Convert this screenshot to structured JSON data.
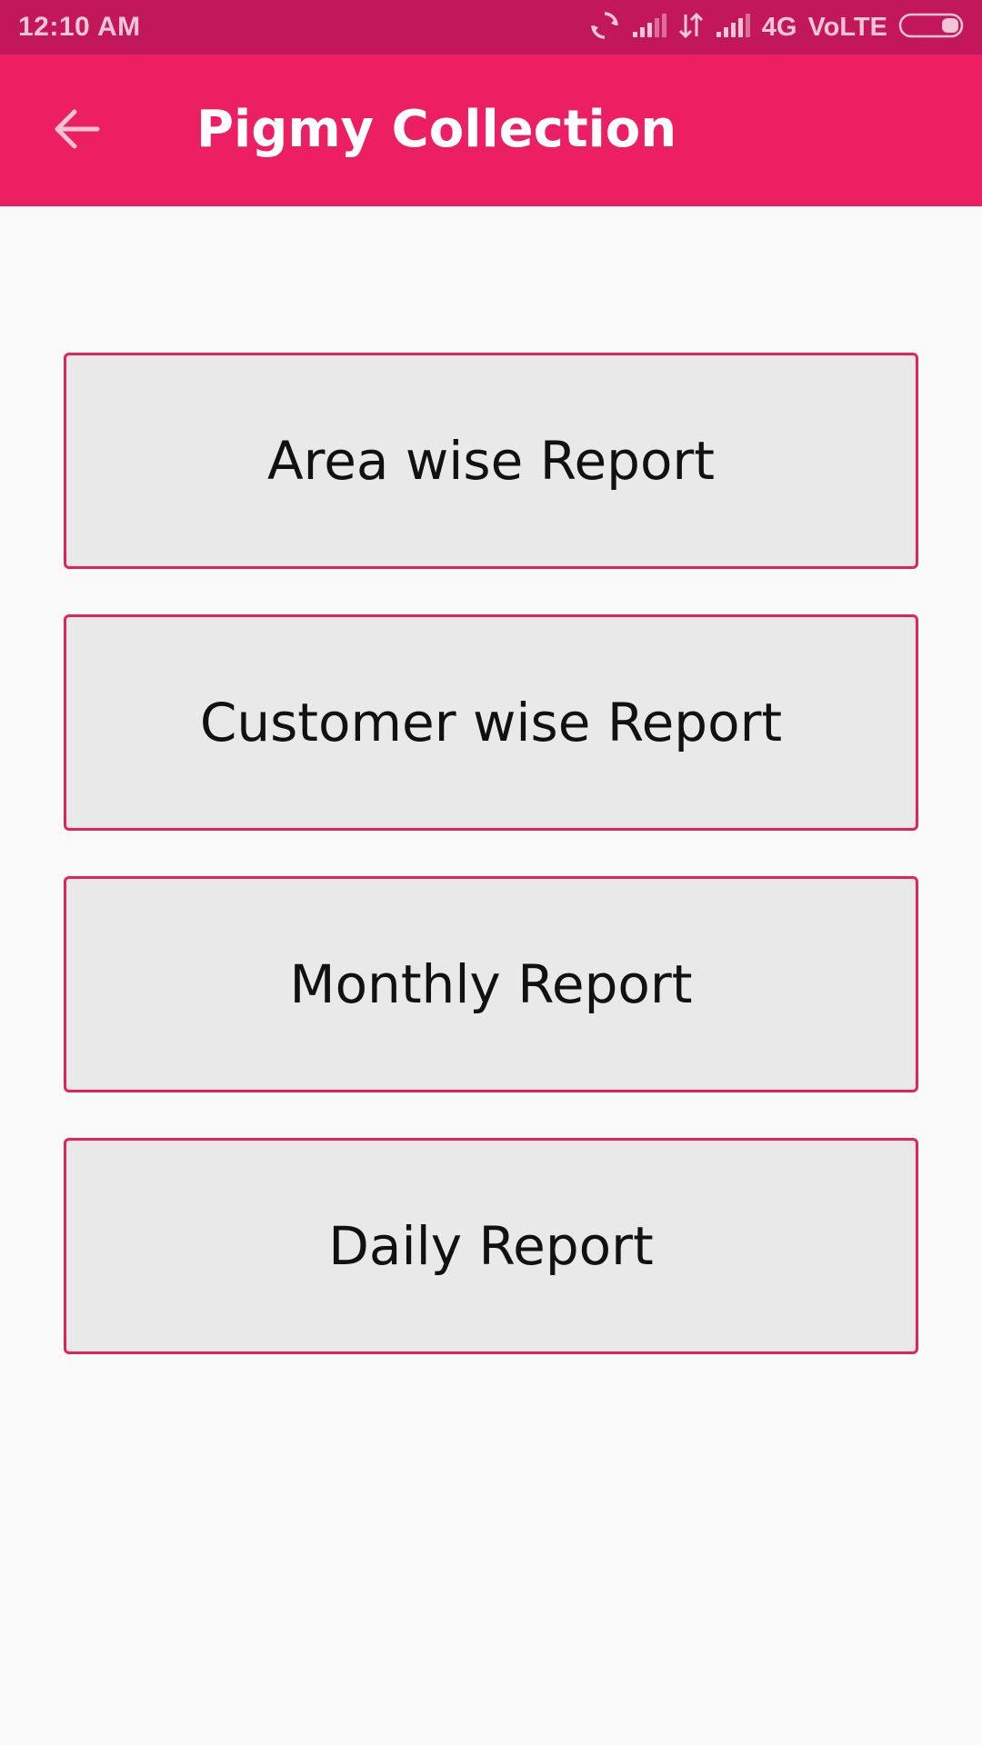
{
  "status_bar": {
    "time": "12:10 AM",
    "network_label": "4G",
    "volte_label": "VoLTE",
    "icons": [
      "sync-icon",
      "signal-icon",
      "data-transfer-icon",
      "signal-icon",
      "battery-icon"
    ]
  },
  "app_bar": {
    "title": "Pigmy Collection",
    "back_icon": "arrow-left-icon"
  },
  "reports": [
    {
      "label": "Area wise Report"
    },
    {
      "label": "Customer wise Report"
    },
    {
      "label": "Monthly Report"
    },
    {
      "label": "Daily Report"
    }
  ],
  "colors": {
    "status_bar": "#c2185b",
    "app_bar": "#ec1f63",
    "button_border": "#e0245e",
    "button_fill": "#e9e9e9",
    "background": "#fafafa"
  }
}
